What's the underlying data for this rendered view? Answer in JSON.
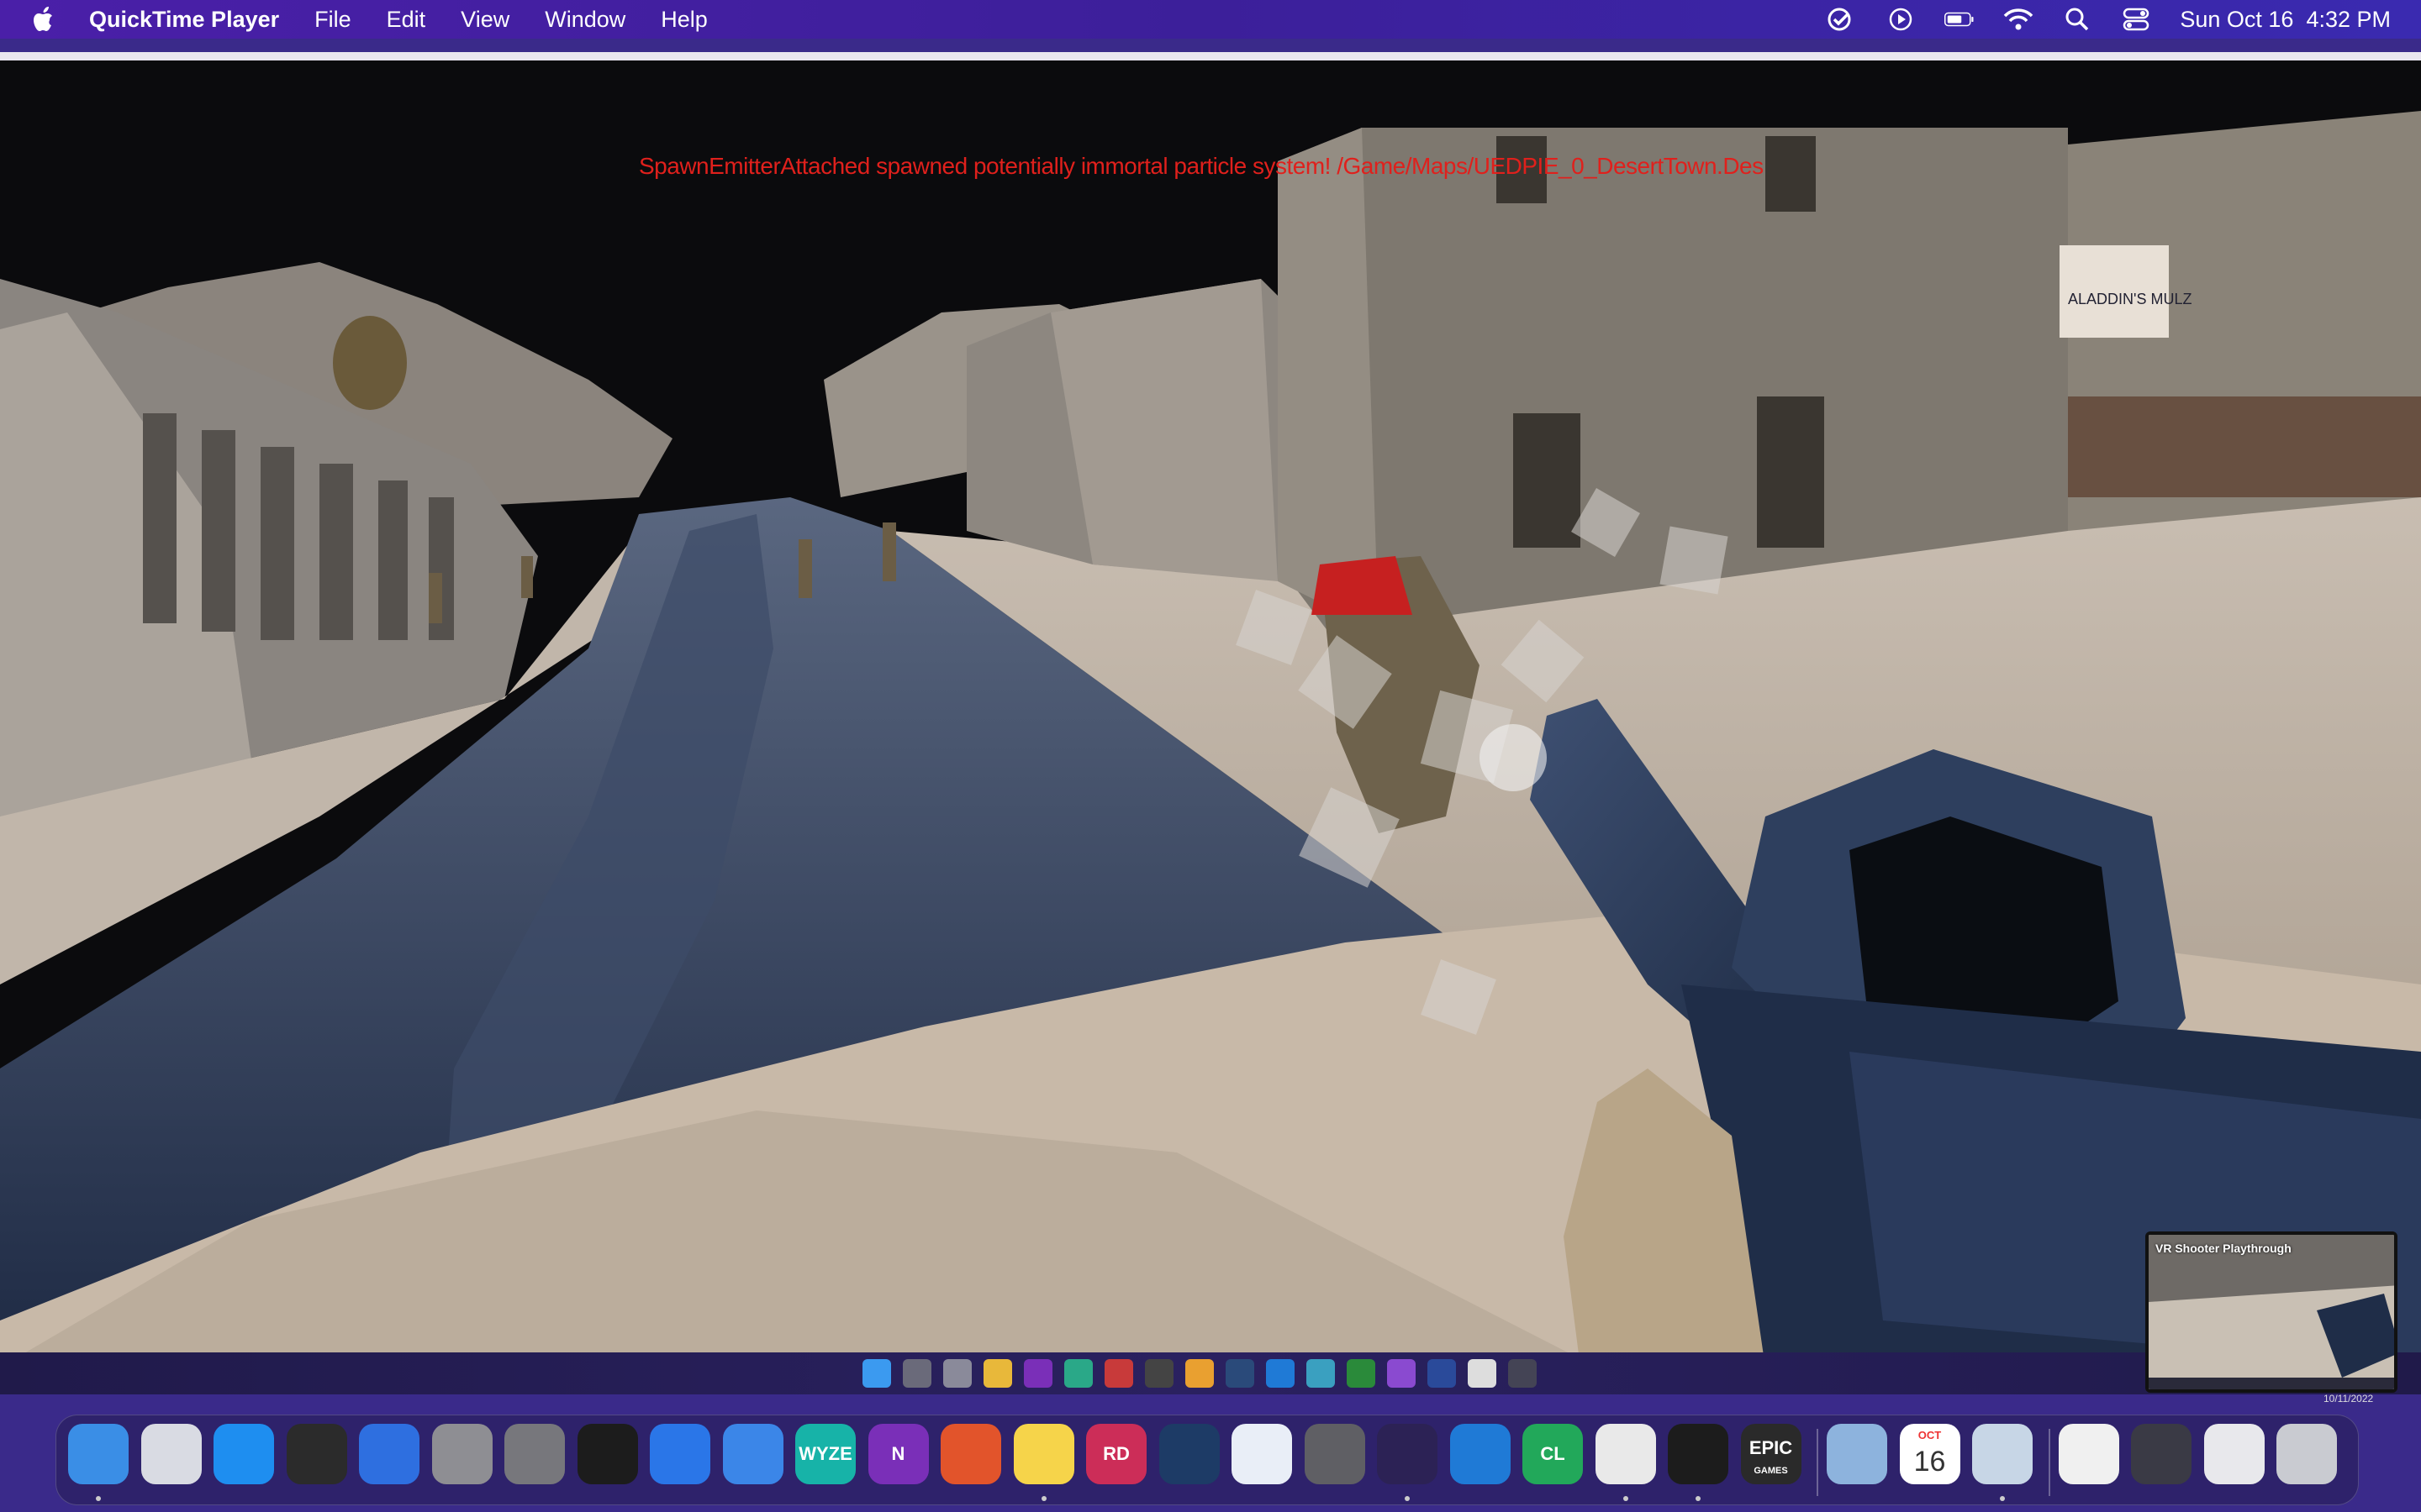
{
  "menubar": {
    "app_name": "QuickTime Player",
    "menus": [
      "File",
      "Edit",
      "View",
      "Window",
      "Help"
    ],
    "status_icons": [
      "checkmark-badge-icon",
      "play-circle-icon",
      "battery-icon",
      "wifi-icon",
      "spotlight-search-icon",
      "control-center-icon"
    ],
    "clock": "Sun Oct 16  4:32 PM"
  },
  "video": {
    "debug_message": "SpawnEmitterAttached spawned potentially immortal particle system! /Game/Maps/UEDPIE_0_DesertTown.Des",
    "shop_sign": "ALADDIN'S MULZ"
  },
  "pip": {
    "title": "VR Shooter Playthrough",
    "date": "10/11/2022"
  },
  "dock": {
    "apps": [
      {
        "name": "Finder",
        "icon": "finder-icon",
        "color": "#3a8ee6"
      },
      {
        "name": "Launchpad",
        "icon": "launchpad-icon",
        "color": "#d9dbe3"
      },
      {
        "name": "App Store",
        "icon": "app-store-icon",
        "color": "#1e8ef0"
      },
      {
        "name": "DVD Player",
        "icon": "dvd-icon",
        "color": "#2b2b2b"
      },
      {
        "name": "Swift Playgrounds",
        "icon": "swift-icon",
        "color": "#2e6fe0"
      },
      {
        "name": "Image Capture",
        "icon": "scanner-icon",
        "color": "#8e8e93"
      },
      {
        "name": "System Preferences",
        "icon": "gear-icon",
        "color": "#77777c"
      },
      {
        "name": "Terminal",
        "icon": "terminal-icon",
        "color": "#1c1c1c"
      },
      {
        "name": "Xcode",
        "icon": "xcode-icon",
        "color": "#2a76e8"
      },
      {
        "name": "Instruments",
        "icon": "hammer-icon",
        "color": "#3b86e8"
      },
      {
        "name": "Wyze",
        "label": "WYZE",
        "icon": "wyze-icon",
        "color": "#17b3a8"
      },
      {
        "name": "OneNote",
        "label": "N",
        "icon": "onenote-icon",
        "color": "#7a2fb8"
      },
      {
        "name": "Remote Desktop",
        "icon": "remote-desktop-icon",
        "color": "#e2542b"
      },
      {
        "name": "Notes",
        "icon": "notes-icon",
        "color": "#f6d44a"
      },
      {
        "name": "Rider",
        "label": "RD",
        "icon": "rider-icon",
        "color": "#cc2d58"
      },
      {
        "name": "Steam",
        "icon": "steam-icon",
        "color": "#1d3b66"
      },
      {
        "name": "Xcode Instruments",
        "icon": "compass-icon",
        "color": "#e9eef7"
      },
      {
        "name": "Unity",
        "icon": "unity-icon",
        "color": "#5f5f64"
      },
      {
        "name": "Eclipse",
        "icon": "eclipse-icon",
        "color": "#2c2255"
      },
      {
        "name": "Visual Studio Code",
        "icon": "vscode-icon",
        "color": "#1f7ad6"
      },
      {
        "name": "CLion",
        "label": "CL",
        "icon": "clion-icon",
        "color": "#22a85a"
      },
      {
        "name": "Chrome",
        "icon": "chrome-icon",
        "color": "#e9e9e9"
      },
      {
        "name": "Terminal 2",
        "icon": "terminal-icon",
        "color": "#1c1c1c"
      },
      {
        "name": "Epic Games",
        "label": "EPIC",
        "icon": "epic-games-icon",
        "color": "#2a2a2a"
      },
      {
        "name": "Preview",
        "icon": "preview-icon",
        "color": "#8db3dd"
      },
      {
        "name": "Calendar",
        "label": "16",
        "icon": "calendar-icon",
        "color": "#ffffff"
      },
      {
        "name": "QuickTime Player",
        "icon": "quicktime-icon",
        "color": "#c7d6e6"
      },
      {
        "name": "HTML File",
        "icon": "document-icon",
        "color": "#f0f0f0"
      },
      {
        "name": "Recent Window 1",
        "icon": "window-thumbnail-icon",
        "color": "#3a3a45"
      },
      {
        "name": "Recent Window 2",
        "icon": "window-thumbnail-icon",
        "color": "#e8e8ec"
      },
      {
        "name": "Trash",
        "icon": "trash-icon",
        "color": "#c9cbd1"
      }
    ],
    "calendar_month": "OCT",
    "epic_sub": "GAMES"
  }
}
